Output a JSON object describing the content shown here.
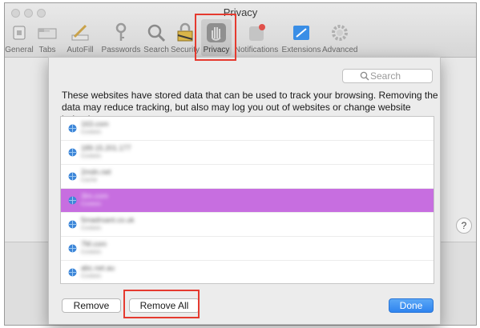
{
  "window": {
    "title": "Privacy"
  },
  "toolbar": {
    "items": [
      {
        "label": "General",
        "icon": "general-icon"
      },
      {
        "label": "Tabs",
        "icon": "tabs-icon"
      },
      {
        "label": "AutoFill",
        "icon": "autofill-icon"
      },
      {
        "label": "Passwords",
        "icon": "key-icon"
      },
      {
        "label": "Search",
        "icon": "magnifier-icon"
      },
      {
        "label": "Security",
        "icon": "lock-icon"
      },
      {
        "label": "Privacy",
        "icon": "hand-icon"
      },
      {
        "label": "Notifications",
        "icon": "notification-icon"
      },
      {
        "label": "Extensions",
        "icon": "puzzle-icon"
      },
      {
        "label": "Advanced",
        "icon": "gear-icon"
      }
    ],
    "active": "Privacy"
  },
  "sheet": {
    "search": {
      "placeholder": "Search"
    },
    "description": "These websites have stored data that can be used to track your browsing. Removing the data may reduce tracking, but also may log you out of websites or change website behavior.",
    "websites": [
      {
        "name": "163.com",
        "kind": "Cookies"
      },
      {
        "name": "189.15.201.177",
        "kind": "Cookies"
      },
      {
        "name": "2mdn.net",
        "kind": "Cache"
      },
      {
        "name": "3lm.com",
        "kind": "Cookies"
      },
      {
        "name": "5madrsant.co.uk",
        "kind": "Cookies"
      },
      {
        "name": "7M.com",
        "kind": "Cookies"
      },
      {
        "name": "abc.net.au",
        "kind": "Cookies"
      }
    ],
    "selected_index": 3,
    "buttons": {
      "remove": "Remove",
      "remove_all": "Remove All",
      "done": "Done"
    }
  },
  "help": {
    "label": "?"
  },
  "colors": {
    "selection": "#c76ee0",
    "highlight": "#e53a2f",
    "primary": "#2f84ef"
  }
}
